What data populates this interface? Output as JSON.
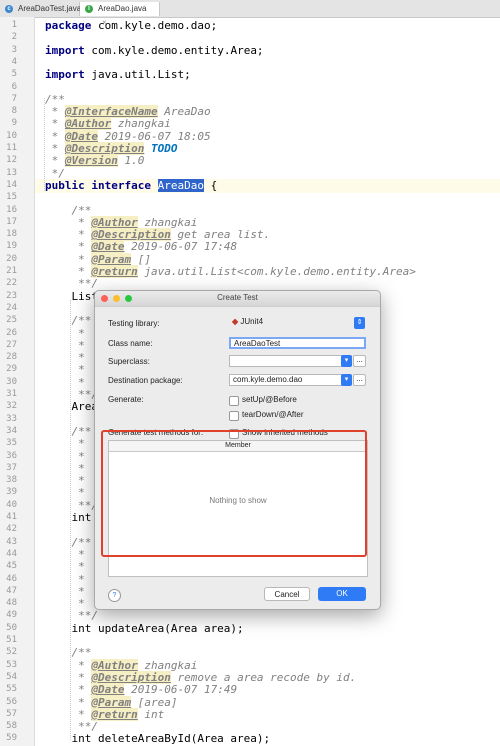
{
  "tabs": [
    {
      "label": "AreaDaoTest.java",
      "icon": "class-c-icon",
      "color": "#3a86d1"
    },
    {
      "label": "AreaDao.java",
      "icon": "interface-i-icon",
      "color": "#3aa64a"
    }
  ],
  "code_lines": [
    {
      "n": "1",
      "text": "package com.kyle.demo.dao;"
    },
    {
      "n": "2",
      "text": ""
    },
    {
      "n": "3",
      "text": "import com.kyle.demo.entity.Area;"
    },
    {
      "n": "4",
      "text": ""
    },
    {
      "n": "5",
      "text": "import java.util.List;"
    },
    {
      "n": "6",
      "text": ""
    },
    {
      "n": "7",
      "text": "/**"
    },
    {
      "n": "8",
      "text": " * @InterfaceName AreaDao"
    },
    {
      "n": "9",
      "text": " * @Author zhangkai"
    },
    {
      "n": "10",
      "text": " * @Date 2019-06-07 18:05"
    },
    {
      "n": "11",
      "text": " * @Description TODO"
    },
    {
      "n": "12",
      "text": " * @Version 1.0"
    },
    {
      "n": "13",
      "text": " */"
    },
    {
      "n": "14",
      "text": "public interface AreaDao {"
    },
    {
      "n": "15",
      "text": ""
    },
    {
      "n": "16",
      "text": "    /**"
    },
    {
      "n": "17",
      "text": "     * @Author zhangkai"
    },
    {
      "n": "18",
      "text": "     * @Description get area list."
    },
    {
      "n": "19",
      "text": "     * @Date 2019-06-07 17:48"
    },
    {
      "n": "20",
      "text": "     * @Param []"
    },
    {
      "n": "21",
      "text": "     * @return java.util.List<com.kyle.demo.entity.Area>"
    },
    {
      "n": "22",
      "text": "     **/"
    },
    {
      "n": "23",
      "text": "    List"
    },
    {
      "n": "24",
      "text": ""
    },
    {
      "n": "25",
      "text": "    /**"
    },
    {
      "n": "26",
      "text": "     *"
    },
    {
      "n": "27",
      "text": "     *"
    },
    {
      "n": "28",
      "text": "     *"
    },
    {
      "n": "29",
      "text": "     *"
    },
    {
      "n": "30",
      "text": "     *"
    },
    {
      "n": "31",
      "text": "     **/"
    },
    {
      "n": "32",
      "text": "    Area"
    },
    {
      "n": "33",
      "text": ""
    },
    {
      "n": "34",
      "text": "    /**"
    },
    {
      "n": "35",
      "text": "     *"
    },
    {
      "n": "36",
      "text": "     *"
    },
    {
      "n": "37",
      "text": "     *"
    },
    {
      "n": "38",
      "text": "     *"
    },
    {
      "n": "39",
      "text": "     *"
    },
    {
      "n": "40",
      "text": "     **/"
    },
    {
      "n": "41",
      "text": "    int"
    },
    {
      "n": "42",
      "text": ""
    },
    {
      "n": "43",
      "text": "    /**"
    },
    {
      "n": "44",
      "text": "     *"
    },
    {
      "n": "45",
      "text": "     *"
    },
    {
      "n": "46",
      "text": "     *"
    },
    {
      "n": "47",
      "text": "     *"
    },
    {
      "n": "48",
      "text": "     *"
    },
    {
      "n": "49",
      "text": "     **/"
    },
    {
      "n": "50",
      "text": "    int updateArea(Area area);"
    },
    {
      "n": "51",
      "text": ""
    },
    {
      "n": "52",
      "text": "    /**"
    },
    {
      "n": "53",
      "text": "     * @Author zhangkai"
    },
    {
      "n": "54",
      "text": "     * @Description remove a area recode by id."
    },
    {
      "n": "55",
      "text": "     * @Date 2019-06-07 17:49"
    },
    {
      "n": "56",
      "text": "     * @Param [area]"
    },
    {
      "n": "57",
      "text": "     * @return int"
    },
    {
      "n": "58",
      "text": "     **/"
    },
    {
      "n": "59",
      "text": "    int deleteAreaById(Area area);"
    }
  ],
  "dialog": {
    "title": "Create Test",
    "testing_library_label": "Testing library:",
    "testing_library_value": "JUnit4",
    "class_name_label": "Class name:",
    "class_name_value": "AreaDaoTest",
    "superclass_label": "Superclass:",
    "superclass_value": "",
    "destination_label": "Destination package:",
    "destination_value": "com.kyle.demo.dao",
    "generate_label": "Generate:",
    "setup_label": "setUp/@Before",
    "teardown_label": "tearDown/@After",
    "methods_label": "Generate test methods for:",
    "show_inherited_label": "Show inherited methods",
    "member_header": "Member",
    "empty_text": "Nothing to show",
    "browse_label": "...",
    "help_label": "?",
    "cancel_label": "Cancel",
    "ok_label": "OK"
  },
  "colors": {
    "accent": "#2f7bf5",
    "highlight_box": "#e0412c",
    "selection": "#2f65ca"
  }
}
